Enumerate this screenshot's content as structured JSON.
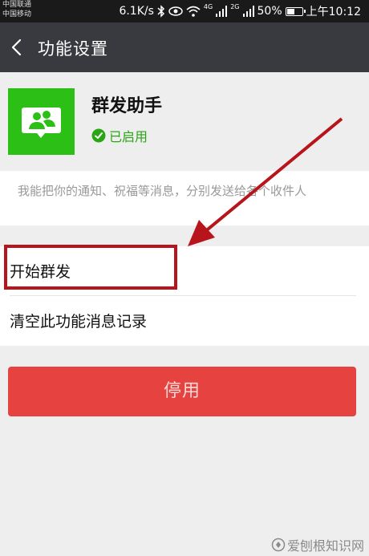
{
  "status_bar": {
    "carrier_1": "中国联通",
    "carrier_2": "中国移动",
    "speed": "6.1K/s",
    "net_1": "4G",
    "net_2": "2G",
    "battery": "50%",
    "battery_level": 0.5,
    "time": "上午10:12"
  },
  "header": {
    "title": "功能设置"
  },
  "app": {
    "name": "群发助手",
    "status": "已启用"
  },
  "description": "我能把你的通知、祝福等消息，分别发送给各个收件人",
  "list": [
    {
      "label": "开始群发"
    },
    {
      "label": "清空此功能消息记录"
    }
  ],
  "disable_button": {
    "label": "停用"
  },
  "watermark": {
    "text": "爱刨根知识网"
  },
  "colors": {
    "title_bar": "#393a3f",
    "accent_green": "#2cc017",
    "danger": "#e64340",
    "annotation": "#b8141b"
  },
  "icons": [
    "back-arrow-icon",
    "group-chat-icon",
    "check-circle-icon",
    "bluetooth-icon",
    "eye-icon",
    "wifi-icon",
    "signal-icon",
    "battery-icon"
  ]
}
